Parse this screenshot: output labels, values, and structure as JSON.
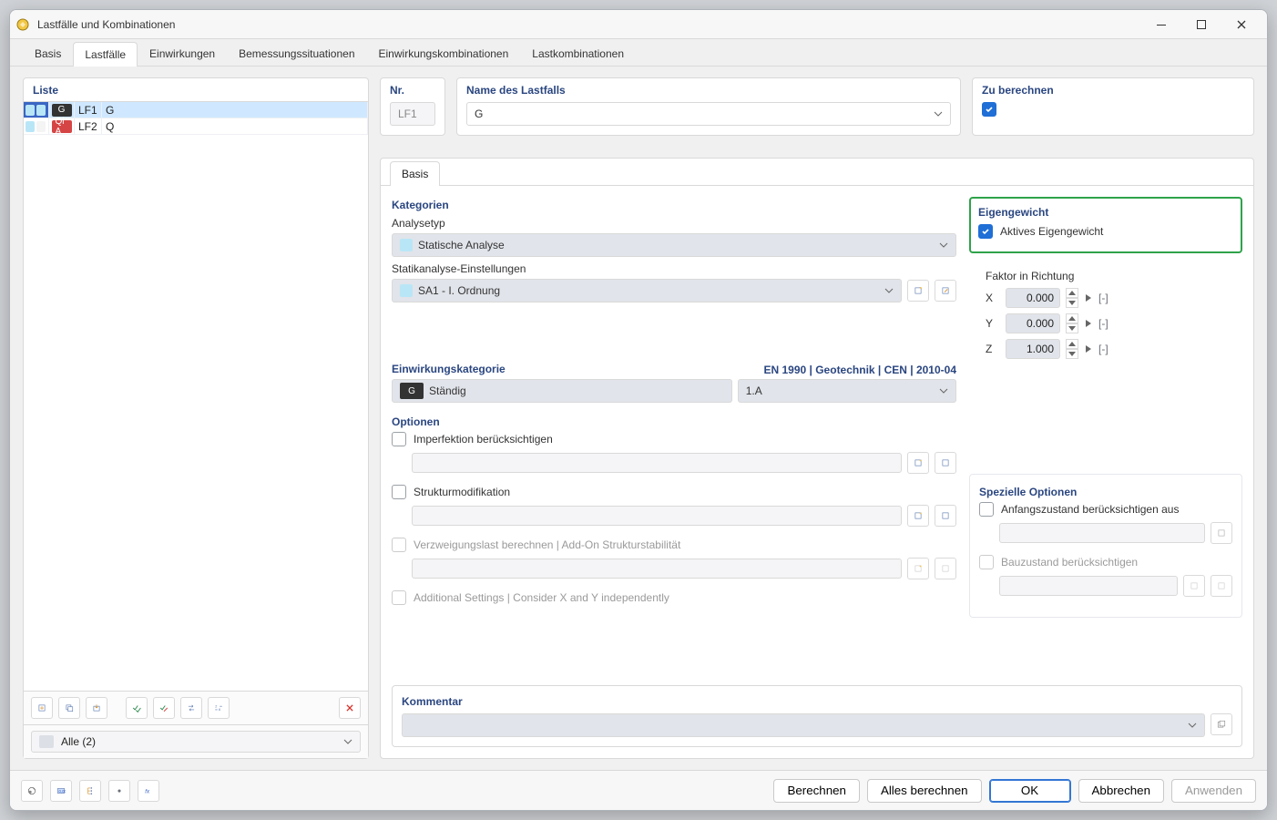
{
  "window": {
    "title": "Lastfälle und Kombinationen"
  },
  "main_tabs": [
    "Basis",
    "Lastfälle",
    "Einwirkungen",
    "Bemessungssituationen",
    "Einwirkungskombinationen",
    "Lastkombinationen"
  ],
  "main_tabs_active": 1,
  "left": {
    "title": "Liste",
    "rows": [
      {
        "badge": "G",
        "badge_class": "badge-g",
        "code": "LF1",
        "name": "G",
        "selected": true,
        "status_colors": [
          "#b9e6f7",
          "#b9e6f7"
        ]
      },
      {
        "badge": "Qi A",
        "badge_class": "badge-qa",
        "code": "LF2",
        "name": "Q",
        "selected": false,
        "status_colors": [
          "#b9e6f7",
          "#f4f4f4"
        ]
      }
    ],
    "filter": {
      "prefix_color": "#dcdfe6",
      "label": "Alle (2)"
    }
  },
  "right_top": {
    "nr_label": "Nr.",
    "nr_value": "LF1",
    "name_label": "Name des Lastfalls",
    "name_value": "G",
    "zu_label": "Zu berechnen",
    "zu_checked": true
  },
  "inner_tabs": [
    "Basis"
  ],
  "inner_tabs_active": 0,
  "categories": {
    "section": "Kategorien",
    "analyse_label": "Analysetyp",
    "analyse_value": "Statische Analyse",
    "settings_label": "Statikanalyse-Einstellungen",
    "settings_value": "SA1 - I. Ordnung"
  },
  "eig": {
    "section": "Eigengewicht",
    "active_label": "Aktives Eigengewicht",
    "active_checked": true,
    "factor_label": "Faktor in Richtung",
    "rows": [
      {
        "axis": "X",
        "value": "0.000",
        "unit": "[-]"
      },
      {
        "axis": "Y",
        "value": "0.000",
        "unit": "[-]"
      },
      {
        "axis": "Z",
        "value": "1.000",
        "unit": "[-]"
      }
    ]
  },
  "einwirk": {
    "section": "Einwirkungskategorie",
    "norm": "EN 1990 | Geotechnik | CEN | 2010-04",
    "tag": "G",
    "label": "Ständig",
    "code": "1.A"
  },
  "options": {
    "section": "Optionen",
    "items": [
      {
        "label": "Imperfektion berücksichtigen",
        "enabled": true,
        "checked": false,
        "has_sub": true
      },
      {
        "label": "Strukturmodifikation",
        "enabled": true,
        "checked": false,
        "has_sub": true
      },
      {
        "label": "Verzweigungslast berechnen | Add-On Strukturstabilität",
        "enabled": false,
        "checked": false,
        "has_sub": true
      },
      {
        "label": "Additional Settings | Consider X and Y independently",
        "enabled": false,
        "checked": false,
        "has_sub": false
      }
    ]
  },
  "special": {
    "section": "Spezielle Optionen",
    "anfang_label": "Anfangszustand berücksichtigen aus",
    "bau_label": "Bauzustand berücksichtigen"
  },
  "comment": {
    "section": "Kommentar"
  },
  "footer": {
    "berechnen": "Berechnen",
    "alles": "Alles berechnen",
    "ok": "OK",
    "abbrechen": "Abbrechen",
    "anwenden": "Anwenden"
  }
}
